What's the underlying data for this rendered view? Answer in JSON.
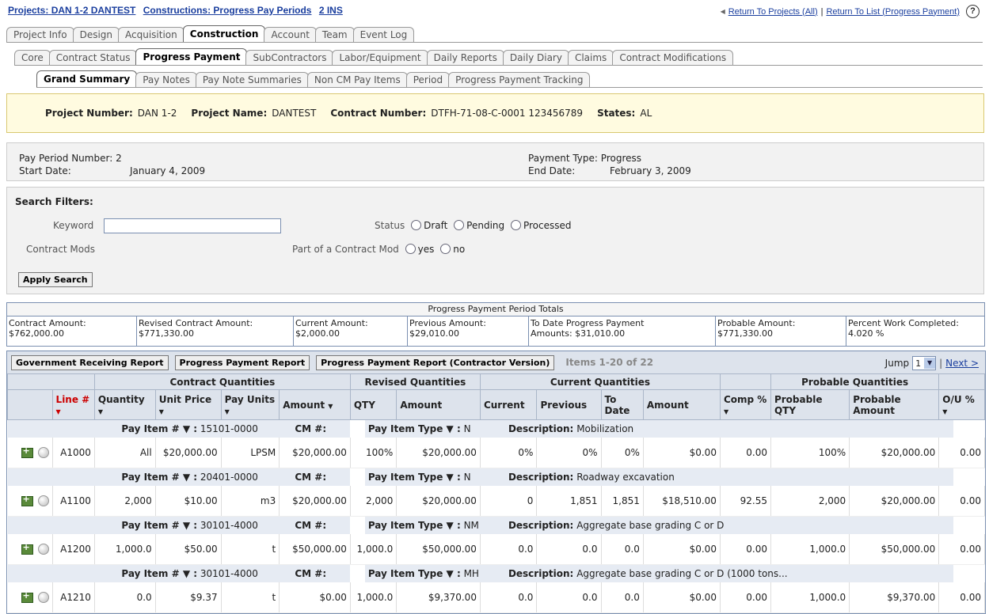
{
  "breadcrumb": {
    "projects_label": "Projects:",
    "project": "DAN 1-2 DANTEST",
    "constructions_label": "Constructions:",
    "progress": "Progress Pay Periods",
    "ins": "2 INS"
  },
  "top_links": {
    "return_projects": "Return To Projects (All)",
    "sep": "|",
    "return_list": "Return To List (Progress Payment)",
    "help": "?"
  },
  "tabs_main": [
    "Project Info",
    "Design",
    "Acquisition",
    "Construction",
    "Account",
    "Team",
    "Event Log"
  ],
  "tabs_sub": [
    "Core",
    "Contract Status",
    "Progress Payment",
    "SubContractors",
    "Labor/Equipment",
    "Daily Reports",
    "Daily Diary",
    "Claims",
    "Contract Modifications"
  ],
  "tabs_sub2": [
    "Grand Summary",
    "Pay Notes",
    "Pay Note Summaries",
    "Non CM Pay Items",
    "Period",
    "Progress Payment Tracking"
  ],
  "project": {
    "number_label": "Project Number:",
    "number": "DAN 1-2",
    "name_label": "Project Name:",
    "name": "DANTEST",
    "contract_label": "Contract Number:",
    "contract": "DTFH-71-08-C-0001 123456789",
    "states_label": "States:",
    "states": "AL"
  },
  "period": {
    "pay_period_label": "Pay Period Number:",
    "pay_period": "2",
    "start_label": "Start Date:",
    "start": "January 4, 2009",
    "payment_type_label": "Payment Type:",
    "payment_type": "Progress",
    "end_label": "End Date:",
    "end": "February 3, 2009"
  },
  "filters": {
    "title": "Search Filters:",
    "keyword_label": "Keyword",
    "keyword_value": "",
    "status_label": "Status",
    "status_options": [
      "Draft",
      "Pending",
      "Processed"
    ],
    "mods_label": "Contract Mods",
    "part_label": "Part of a Contract Mod",
    "part_options": [
      "yes",
      "no"
    ],
    "apply": "Apply Search"
  },
  "totals": {
    "title": "Progress Payment Period Totals",
    "cells": [
      {
        "label": "Contract Amount:",
        "value": "$762,000.00"
      },
      {
        "label": "Revised Contract Amount:",
        "value": "$771,330.00"
      },
      {
        "label": "Current Amount:",
        "value": "$2,000.00"
      },
      {
        "label": "Previous Amount:",
        "value": "$29,010.00"
      },
      {
        "label": "To Date Progress Payment",
        "value": "Amounts: $31,010.00"
      },
      {
        "label": "Probable Amount:",
        "value": "$771,330.00"
      },
      {
        "label": "Percent Work Completed:",
        "value": "4.020 %"
      }
    ]
  },
  "toolbar": {
    "gov_report": "Government Receiving Report",
    "pp_report": "Progress Payment Report",
    "pp_contractor": "Progress Payment Report (Contractor Version)",
    "items": "Items 1-20 of 22",
    "jump_label": "Jump",
    "jump_value": "1",
    "next": "Next >"
  },
  "groups": {
    "contract": "Contract Quantities",
    "revised": "Revised Quantities",
    "current": "Current Quantities",
    "probable": "Probable Quantities"
  },
  "cols": {
    "line": "Line #",
    "quantity": "Quantity",
    "unit_price": "Unit Price",
    "pay_units": "Pay Units",
    "amount": "Amount",
    "qty": "QTY",
    "r_amount": "Amount",
    "current": "Current",
    "previous": "Previous",
    "to_date": "To Date",
    "c_amount": "Amount",
    "comp": "Comp %",
    "prob_qty": "Probable QTY",
    "prob_amount": "Probable Amount",
    "ou": "O/U %",
    "sort": "▼"
  },
  "info_labels": {
    "pay_item": "Pay Item # ▼ :",
    "cm": "CM #:",
    "type": "Pay Item Type ▼ :",
    "desc": "Description:"
  },
  "rows": [
    {
      "pay_item": "15101-0000",
      "type": "N",
      "desc": "Mobilization",
      "line": "A1000",
      "quantity": "All",
      "unit_price": "$20,000.00",
      "units": "LPSM",
      "amount": "$20,000.00",
      "qty": "100%",
      "r_amount": "$20,000.00",
      "current": "0%",
      "previous": "0%",
      "to_date": "0%",
      "c_amount": "$0.00",
      "comp": "0.00",
      "prob_qty": "100%",
      "prob_amount": "$20,000.00",
      "ou": "0.00"
    },
    {
      "pay_item": "20401-0000",
      "type": "N",
      "desc": "Roadway excavation",
      "line": "A1100",
      "quantity": "2,000",
      "unit_price": "$10.00",
      "units": "m3",
      "amount": "$20,000.00",
      "qty": "2,000",
      "r_amount": "$20,000.00",
      "current": "0",
      "previous": "1,851",
      "to_date": "1,851",
      "c_amount": "$18,510.00",
      "comp": "92.55",
      "prob_qty": "2,000",
      "prob_amount": "$20,000.00",
      "ou": "0.00"
    },
    {
      "pay_item": "30101-4000",
      "type": "NM",
      "desc": "Aggregate base grading C or D",
      "line": "A1200",
      "quantity": "1,000.0",
      "unit_price": "$50.00",
      "units": "t",
      "amount": "$50,000.00",
      "qty": "1,000.0",
      "r_amount": "$50,000.00",
      "current": "0.0",
      "previous": "0.0",
      "to_date": "0.0",
      "c_amount": "$0.00",
      "comp": "0.00",
      "prob_qty": "1,000.0",
      "prob_amount": "$50,000.00",
      "ou": "0.00"
    },
    {
      "pay_item": "30101-4000",
      "type": "MH",
      "desc": "Aggregate base grading C or D (1000 tons...",
      "line": "A1210",
      "quantity": "0.0",
      "unit_price": "$9.37",
      "units": "t",
      "amount": "$0.00",
      "qty": "1,000.0",
      "r_amount": "$9,370.00",
      "current": "0.0",
      "previous": "0.0",
      "to_date": "0.0",
      "c_amount": "$0.00",
      "comp": "0.00",
      "prob_qty": "1,000.0",
      "prob_amount": "$9,370.00",
      "ou": "0.00"
    }
  ]
}
